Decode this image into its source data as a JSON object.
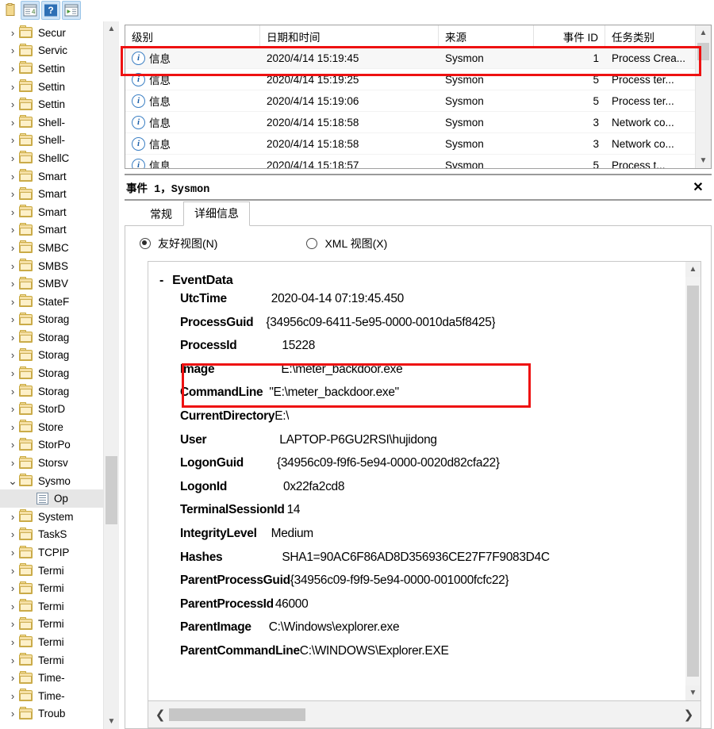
{
  "toolbar": {
    "buttons": [
      {
        "name": "copy-icon",
        "selected": false
      },
      {
        "name": "properties-icon",
        "selected": true
      },
      {
        "name": "help-icon",
        "selected": true
      },
      {
        "name": "view-icon",
        "selected": true
      }
    ]
  },
  "tree": {
    "items": [
      {
        "label": "Secur",
        "type": "folder",
        "expanded": false,
        "selected": false,
        "indent": 0
      },
      {
        "label": "Servic",
        "type": "folder",
        "expanded": false,
        "selected": false,
        "indent": 0
      },
      {
        "label": "Settin",
        "type": "folder",
        "expanded": false,
        "selected": false,
        "indent": 0
      },
      {
        "label": "Settin",
        "type": "folder",
        "expanded": false,
        "selected": false,
        "indent": 0
      },
      {
        "label": "Settin",
        "type": "folder",
        "expanded": false,
        "selected": false,
        "indent": 0
      },
      {
        "label": "Shell-",
        "type": "folder",
        "expanded": false,
        "selected": false,
        "indent": 0
      },
      {
        "label": "Shell-",
        "type": "folder",
        "expanded": false,
        "selected": false,
        "indent": 0
      },
      {
        "label": "ShellC",
        "type": "folder",
        "expanded": false,
        "selected": false,
        "indent": 0
      },
      {
        "label": "Smart",
        "type": "folder",
        "expanded": false,
        "selected": false,
        "indent": 0
      },
      {
        "label": "Smart",
        "type": "folder",
        "expanded": false,
        "selected": false,
        "indent": 0
      },
      {
        "label": "Smart",
        "type": "folder",
        "expanded": false,
        "selected": false,
        "indent": 0
      },
      {
        "label": "Smart",
        "type": "folder",
        "expanded": false,
        "selected": false,
        "indent": 0
      },
      {
        "label": "SMBC",
        "type": "folder",
        "expanded": false,
        "selected": false,
        "indent": 0
      },
      {
        "label": "SMBS",
        "type": "folder",
        "expanded": false,
        "selected": false,
        "indent": 0
      },
      {
        "label": "SMBV",
        "type": "folder",
        "expanded": false,
        "selected": false,
        "indent": 0
      },
      {
        "label": "StateF",
        "type": "folder",
        "expanded": false,
        "selected": false,
        "indent": 0
      },
      {
        "label": "Storag",
        "type": "folder",
        "expanded": false,
        "selected": false,
        "indent": 0
      },
      {
        "label": "Storag",
        "type": "folder",
        "expanded": false,
        "selected": false,
        "indent": 0
      },
      {
        "label": "Storag",
        "type": "folder",
        "expanded": false,
        "selected": false,
        "indent": 0
      },
      {
        "label": "Storag",
        "type": "folder",
        "expanded": false,
        "selected": false,
        "indent": 0
      },
      {
        "label": "Storag",
        "type": "folder",
        "expanded": false,
        "selected": false,
        "indent": 0
      },
      {
        "label": "StorD",
        "type": "folder",
        "expanded": false,
        "selected": false,
        "indent": 0
      },
      {
        "label": "Store",
        "type": "folder",
        "expanded": false,
        "selected": false,
        "indent": 0
      },
      {
        "label": "StorPo",
        "type": "folder",
        "expanded": false,
        "selected": false,
        "indent": 0
      },
      {
        "label": "Storsv",
        "type": "folder",
        "expanded": false,
        "selected": false,
        "indent": 0
      },
      {
        "label": "Sysmo",
        "type": "folder",
        "expanded": true,
        "selected": false,
        "indent": 0
      },
      {
        "label": "Op",
        "type": "log",
        "expanded": false,
        "selected": true,
        "indent": 1
      },
      {
        "label": "System",
        "type": "folder",
        "expanded": false,
        "selected": false,
        "indent": 0
      },
      {
        "label": "TaskS",
        "type": "folder",
        "expanded": false,
        "selected": false,
        "indent": 0
      },
      {
        "label": "TCPIP",
        "type": "folder",
        "expanded": false,
        "selected": false,
        "indent": 0
      },
      {
        "label": "Termi",
        "type": "folder",
        "expanded": false,
        "selected": false,
        "indent": 0
      },
      {
        "label": "Termi",
        "type": "folder",
        "expanded": false,
        "selected": false,
        "indent": 0
      },
      {
        "label": "Termi",
        "type": "folder",
        "expanded": false,
        "selected": false,
        "indent": 0
      },
      {
        "label": "Termi",
        "type": "folder",
        "expanded": false,
        "selected": false,
        "indent": 0
      },
      {
        "label": "Termi",
        "type": "folder",
        "expanded": false,
        "selected": false,
        "indent": 0
      },
      {
        "label": "Termi",
        "type": "folder",
        "expanded": false,
        "selected": false,
        "indent": 0
      },
      {
        "label": "Time-",
        "type": "folder",
        "expanded": false,
        "selected": false,
        "indent": 0
      },
      {
        "label": "Time-",
        "type": "folder",
        "expanded": false,
        "selected": false,
        "indent": 0
      },
      {
        "label": "Troub",
        "type": "folder",
        "expanded": false,
        "selected": false,
        "indent": 0
      }
    ]
  },
  "event_list": {
    "columns": [
      "级别",
      "日期和时间",
      "来源",
      "事件 ID",
      "任务类别"
    ],
    "rows": [
      {
        "level": "信息",
        "datetime": "2020/4/14 15:19:45",
        "source": "Sysmon",
        "event_id": "1",
        "task": "Process Crea...",
        "highlighted": true
      },
      {
        "level": "信息",
        "datetime": "2020/4/14 15:19:25",
        "source": "Sysmon",
        "event_id": "5",
        "task": "Process ter...",
        "highlighted": false
      },
      {
        "level": "信息",
        "datetime": "2020/4/14 15:19:06",
        "source": "Sysmon",
        "event_id": "5",
        "task": "Process ter...",
        "highlighted": false
      },
      {
        "level": "信息",
        "datetime": "2020/4/14 15:18:58",
        "source": "Sysmon",
        "event_id": "3",
        "task": "Network co...",
        "highlighted": false
      },
      {
        "level": "信息",
        "datetime": "2020/4/14 15:18:58",
        "source": "Sysmon",
        "event_id": "3",
        "task": "Network co...",
        "highlighted": false
      },
      {
        "level": "信息",
        "datetime": "2020/4/14 15:18:57",
        "source": "Sysmon",
        "event_id": "5",
        "task": "Process t...",
        "highlighted": false
      }
    ]
  },
  "detail": {
    "title": "事件 1，Sysmon",
    "close_label": "✕",
    "tabs": [
      {
        "label": "常规",
        "active": false
      },
      {
        "label": "详细信息",
        "active": true
      }
    ],
    "view_modes": [
      {
        "label": "友好视图(N)",
        "selected": true
      },
      {
        "label": "XML 视图(X)",
        "selected": false
      }
    ],
    "root_node": "EventData",
    "collapse_glyph": "-",
    "fields": [
      {
        "key": "UtcTime",
        "value": "2020-04-14 07:19:45.450",
        "gap": 56,
        "highlighted": false
      },
      {
        "key": "ProcessGuid",
        "value": "{34956c09-6411-5e95-0000-0010da5f8425}",
        "gap": 16,
        "highlighted": false
      },
      {
        "key": "ProcessId",
        "value": "15228",
        "gap": 57,
        "highlighted": false
      },
      {
        "key": "Image",
        "value": "E:\\meter_backdoor.exe",
        "gap": 84,
        "highlighted": true
      },
      {
        "key": "CommandLine",
        "value": "\"E:\\meter_backdoor.exe\"",
        "gap": 8,
        "highlighted": true
      },
      {
        "key": "CurrentDirectory",
        "value": "E:\\",
        "gap": 0,
        "highlighted": false
      },
      {
        "key": "User",
        "value": "LAPTOP-P6GU2RSI\\hujidong",
        "gap": 92,
        "highlighted": false
      },
      {
        "key": "LogonGuid",
        "value": "{34956c09-f9f6-5e94-0000-0020d82cfa22}",
        "gap": 42,
        "highlighted": false
      },
      {
        "key": "LogonId",
        "value": "0x22fa2cd8",
        "gap": 71,
        "highlighted": false
      },
      {
        "key": "TerminalSessionId",
        "value": "14",
        "gap": 3,
        "highlighted": false
      },
      {
        "key": "IntegrityLevel",
        "value": "Medium",
        "gap": 18,
        "highlighted": false
      },
      {
        "key": "Hashes",
        "value": "SHA1=90AC6F86AD8D356936CE27F7F9083D4C",
        "gap": 75,
        "highlighted": false
      },
      {
        "key": "ParentProcessGuid",
        "value": "{34956c09-f9f9-5e94-0000-001000fcfc22}",
        "gap": 0,
        "highlighted": false
      },
      {
        "key": "ParentProcessId",
        "value": "46000",
        "gap": 2,
        "highlighted": false
      },
      {
        "key": "ParentImage",
        "value": "C:\\Windows\\explorer.exe",
        "gap": 22,
        "highlighted": false
      },
      {
        "key": "ParentCommandLine",
        "value": "C:\\WINDOWS\\Explorer.EXE",
        "gap": 0,
        "highlighted": false
      }
    ],
    "hscroll": {
      "left_arrow": "❮",
      "right_arrow": "❯"
    }
  },
  "colors": {
    "annotation_red": "#ee1111",
    "info_blue": "#3b7fc4",
    "selection_gray": "#e6e6e6"
  }
}
